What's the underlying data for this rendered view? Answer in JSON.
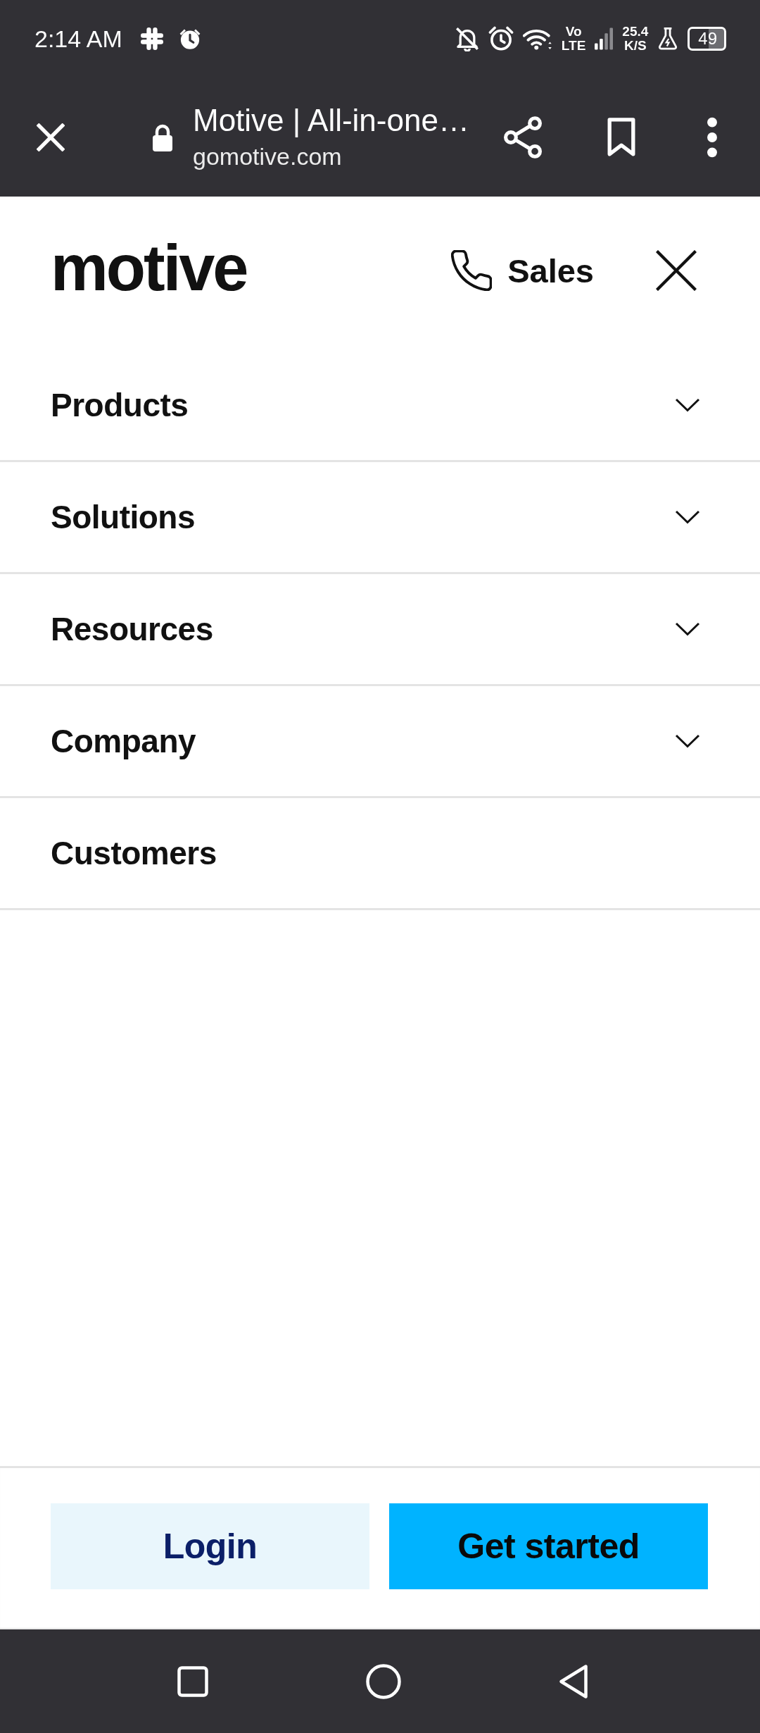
{
  "status_bar": {
    "time": "2:14 AM",
    "network_type": [
      "Vo",
      "LTE"
    ],
    "net_speed": {
      "value": "25.4",
      "unit": "K/S"
    },
    "battery": "49"
  },
  "browser_bar": {
    "title": "Motive | All-in-one…",
    "url": "gomotive.com"
  },
  "header": {
    "logo": "motive",
    "sales_link": "Sales"
  },
  "menu": {
    "items": [
      {
        "label": "Products",
        "kind": "dropdown",
        "expanded": false
      },
      {
        "label": "Solutions",
        "kind": "dropdown",
        "expanded": false
      },
      {
        "label": "Resources",
        "kind": "dropdown",
        "expanded": false
      },
      {
        "label": "Company",
        "kind": "dropdown",
        "expanded": false
      },
      {
        "label": "Customers",
        "kind": "link"
      }
    ]
  },
  "footer": {
    "buttons": [
      {
        "label": "Login",
        "kind": "secondary"
      },
      {
        "label": "Get started",
        "kind": "primary"
      }
    ]
  }
}
